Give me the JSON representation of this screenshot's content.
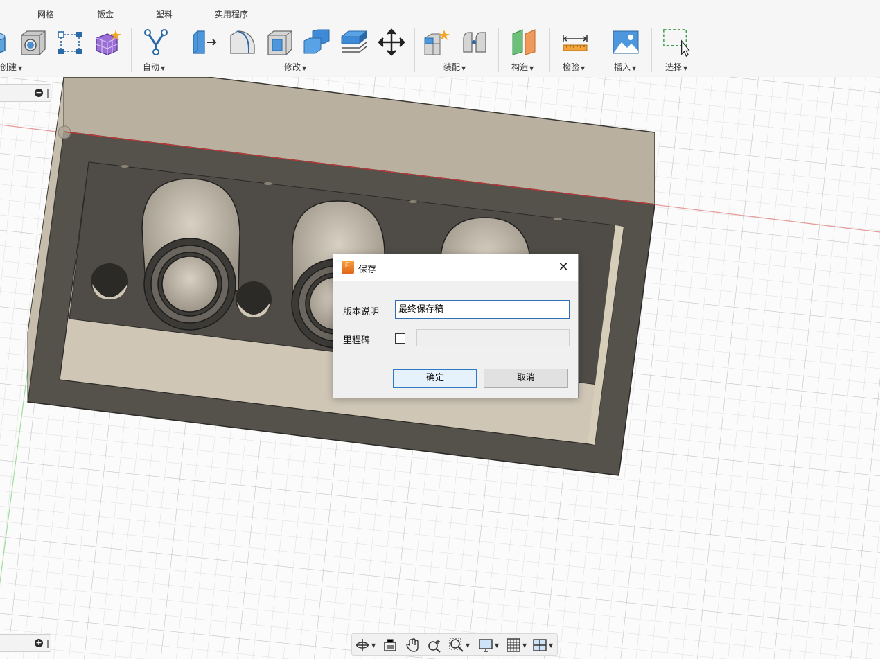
{
  "tabs": [
    "网格",
    "钣金",
    "塑料",
    "实用程序"
  ],
  "ribbon_groups": {
    "create": "创建",
    "automate": "自动",
    "modify": "修改",
    "assemble": "装配",
    "construct": "构造",
    "inspect": "检验",
    "insert": "插入",
    "select": "选择"
  },
  "ribbon_icons": [
    "revolve-icon",
    "hole-icon",
    "pattern-icon",
    "create-form-icon",
    "automated-modeling-icon",
    "press-pull-icon",
    "fillet-icon",
    "shell-icon",
    "combine-icon",
    "offset-face-icon",
    "move-icon",
    "new-component-icon",
    "joint-icon",
    "offset-plane-icon",
    "measure-icon",
    "insert-canvas-icon",
    "window-select-icon"
  ],
  "dialog": {
    "title": "保存",
    "version_label": "版本说明",
    "version_value": "最终保存稿",
    "milestone_label": "里程碑",
    "milestone_checked": false,
    "ok_label": "确定",
    "cancel_label": "取消"
  },
  "colors": {
    "accent": "#2f79c9",
    "app_icon": "#e0641a",
    "model_face": "#58544d",
    "model_top": "#b7ad9c"
  },
  "navbar_icons": [
    "orbit-icon",
    "look-at-icon",
    "pan-icon",
    "zoom-icon",
    "fit-icon",
    "display-settings-icon",
    "grid-snap-icon",
    "viewports-icon"
  ]
}
